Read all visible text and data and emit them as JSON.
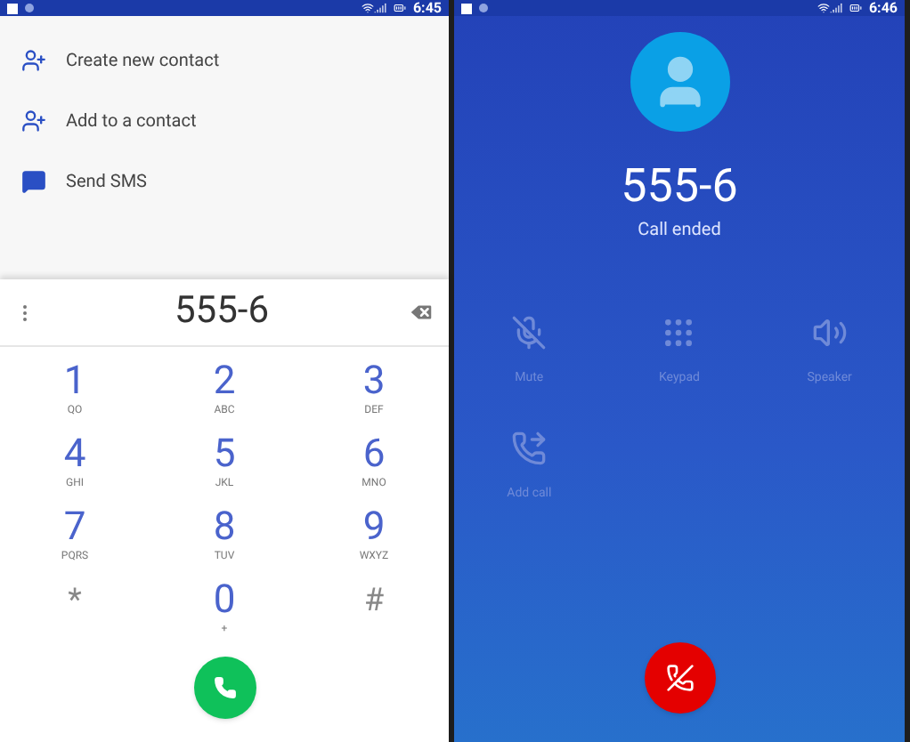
{
  "left_screen": {
    "status_bar": {
      "time": "6:45"
    },
    "actions": [
      {
        "kind": "add-person",
        "label": "Create new contact"
      },
      {
        "kind": "add-person",
        "label": "Add to a contact"
      },
      {
        "kind": "message",
        "label": "Send SMS"
      }
    ],
    "dial_field": {
      "value": "555-6"
    },
    "keypad": [
      {
        "digit": "1",
        "letters": "QO"
      },
      {
        "digit": "2",
        "letters": "ABC"
      },
      {
        "digit": "3",
        "letters": "DEF"
      },
      {
        "digit": "4",
        "letters": "GHI"
      },
      {
        "digit": "5",
        "letters": "JKL"
      },
      {
        "digit": "6",
        "letters": "MNO"
      },
      {
        "digit": "7",
        "letters": "PQRS"
      },
      {
        "digit": "8",
        "letters": "TUV"
      },
      {
        "digit": "9",
        "letters": "WXYZ"
      },
      {
        "digit": "*",
        "kind": "symbol"
      },
      {
        "digit": "0",
        "letters": "+"
      },
      {
        "digit": "#",
        "kind": "symbol"
      }
    ]
  },
  "right_screen": {
    "status_bar": {
      "time": "6:46"
    },
    "caller_number": "555-6",
    "call_status": "Call ended",
    "controls": [
      {
        "kind": "mute",
        "label": "Mute",
        "disabled": true
      },
      {
        "kind": "keypad",
        "label": "Keypad",
        "disabled": true
      },
      {
        "kind": "speaker",
        "label": "Speaker",
        "disabled": true
      },
      {
        "kind": "add-call",
        "label": "Add call",
        "disabled": true
      }
    ]
  }
}
